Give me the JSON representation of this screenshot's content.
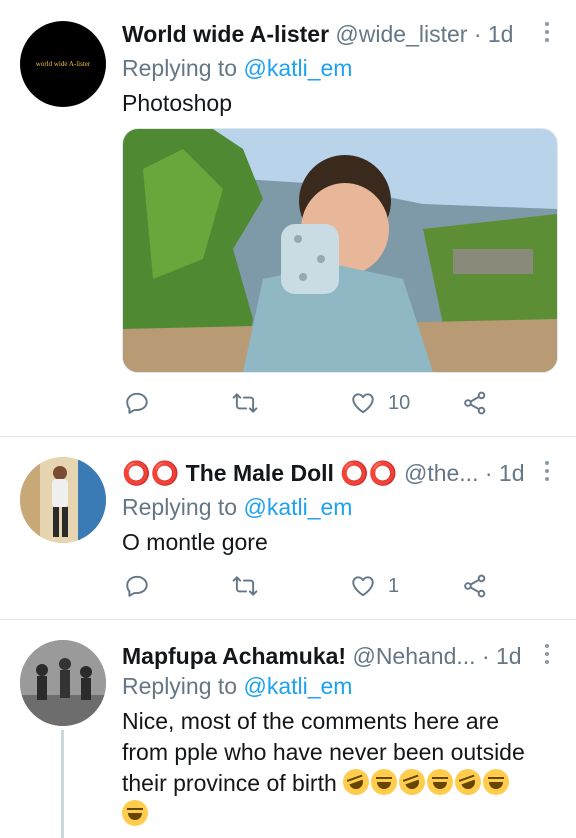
{
  "tweets": [
    {
      "display_name": "World wide A-lister",
      "handle": "@wide_lister",
      "time": "· 1d",
      "avatar_text": "world wide A-lister",
      "replying_label": "Replying to",
      "replying_to": "@katli_em",
      "text": "Photoshop",
      "actions": {
        "reply_count": "",
        "retweet_count": "",
        "like_count": "10"
      }
    },
    {
      "display_name": "⭕⭕ The Male Doll ⭕⭕",
      "handle": "@the...",
      "time": "· 1d",
      "replying_label": "Replying to",
      "replying_to": "@katli_em",
      "text": "O montle gore",
      "actions": {
        "reply_count": "",
        "retweet_count": "",
        "like_count": "1"
      }
    },
    {
      "display_name": "Mapfupa Achamuka!",
      "handle": "@Nehand...",
      "time": "· 1d",
      "replying_label": "Replying to",
      "replying_to": "@katli_em",
      "text_lines": [
        "Nice, most of the comments here are",
        "from pple who have never been outside",
        "their province of birth"
      ]
    }
  ],
  "colors": {
    "link": "#1da1f2",
    "muted": "#657786",
    "divider": "#e1e8ed"
  },
  "icons": [
    "reply-icon",
    "retweet-icon",
    "heart-icon",
    "share-icon",
    "more-icon",
    "rofl-emoji",
    "joy-emoji"
  ]
}
